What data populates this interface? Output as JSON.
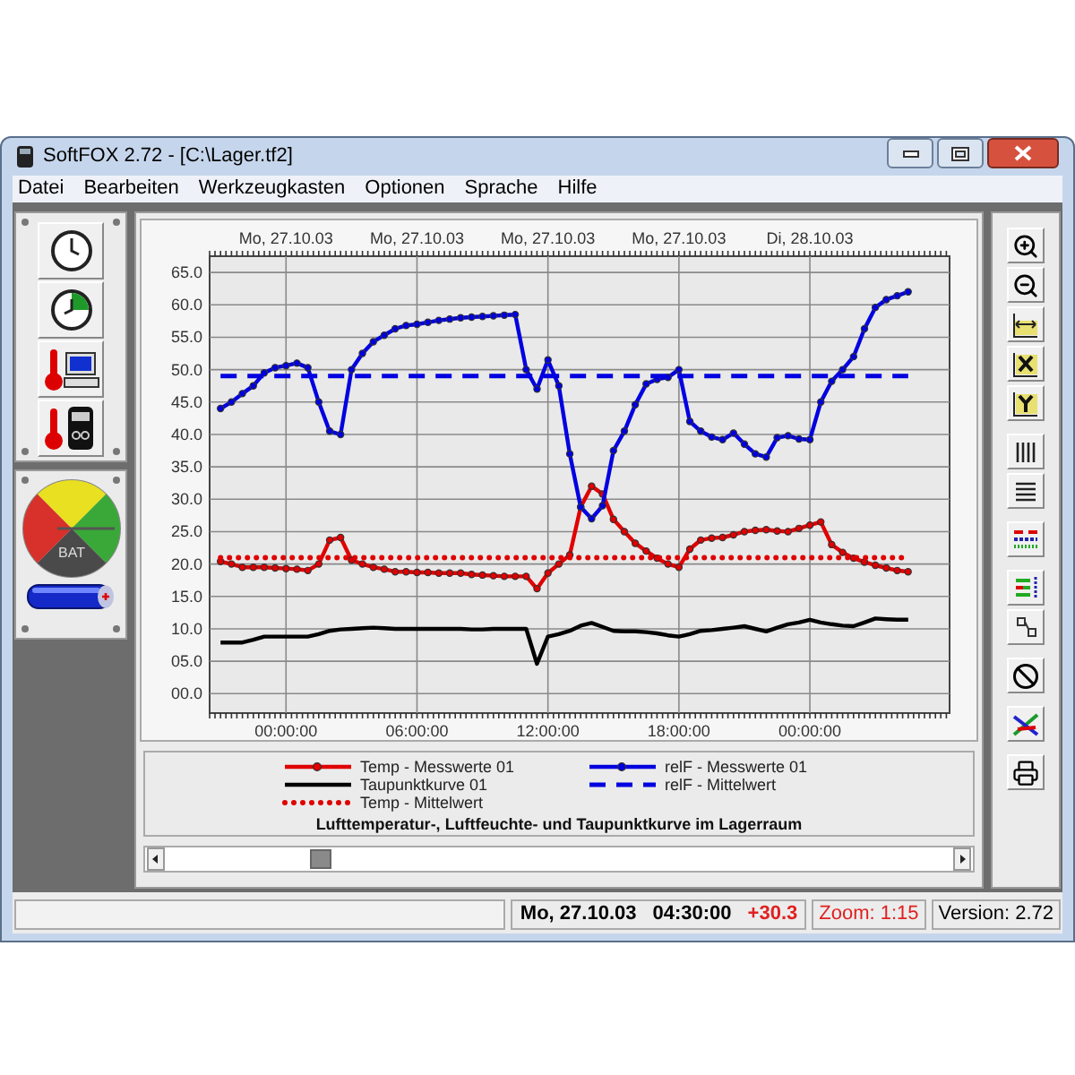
{
  "window": {
    "title": "SoftFOX 2.72 - [C:\\Lager.tf2]"
  },
  "menu": [
    "Datei",
    "Bearbeiten",
    "Werkzeugkasten",
    "Optionen",
    "Sprache",
    "Hilfe"
  ],
  "battery_gauge": {
    "label": "BAT"
  },
  "chart": {
    "date_labels": [
      "Mo, 27.10.03",
      "Mo, 27.10.03",
      "Mo, 27.10.03",
      "Mo, 27.10.03",
      "Di, 28.10.03"
    ],
    "chart_data": {
      "type": "line",
      "title": "Lufttemperatur-, Luftfeuchte- und Taupunktkurve im Lagerraum",
      "grid": true,
      "x": [
        "--10-26 21:00",
        "--10-26 21:30",
        "--10-26 22:00",
        "--10-26 22:30",
        "--10-26 23:00",
        "--10-26 23:30",
        "--10-27 00:00",
        "--10-27 00:30",
        "--10-27 01:00",
        "--10-27 01:30",
        "--10-27 02:00",
        "--10-27 02:30",
        "--10-27 03:00",
        "--10-27 03:30",
        "--10-27 04:00",
        "--10-27 04:30",
        "--10-27 05:00",
        "--10-27 05:30",
        "--10-27 06:00",
        "--10-27 06:30",
        "--10-27 07:00",
        "--10-27 07:30",
        "--10-27 08:00",
        "--10-27 08:30",
        "--10-27 09:00",
        "--10-27 09:30",
        "--10-27 10:00",
        "--10-27 10:30",
        "--10-27 11:00",
        "--10-27 11:30",
        "--10-27 12:00",
        "--10-27 12:30",
        "--10-27 13:00",
        "--10-27 13:30",
        "--10-27 14:00",
        "--10-27 14:30",
        "--10-27 15:00",
        "--10-27 15:30",
        "--10-27 16:00",
        "--10-27 16:30",
        "--10-27 17:00",
        "--10-27 17:30",
        "--10-27 18:00",
        "--10-27 18:30",
        "--10-27 19:00",
        "--10-27 19:30",
        "--10-27 20:00",
        "--10-27 20:30",
        "--10-27 21:00",
        "--10-27 21:30",
        "--10-27 22:00",
        "--10-27 22:30",
        "--10-27 23:00",
        "--10-27 23:30",
        "--10-28 00:00",
        "--10-28 00:30",
        "--10-28 01:00",
        "--10-28 01:30",
        "--10-28 02:00",
        "--10-28 02:30",
        "--10-28 03:00",
        "--10-28 03:30",
        "--10-28 04:00",
        "--10-28 04:30"
      ],
      "xlim": [
        "--10-26 20:30",
        "--10-28 06:24"
      ],
      "ylim": [
        -3,
        67.5
      ],
      "xticks": [
        {
          "value": "--10-27 00:00",
          "label": "00:00:00"
        },
        {
          "value": "--10-27 06:00",
          "label": "06:00:00"
        },
        {
          "value": "--10-27 12:00",
          "label": "12:00:00"
        },
        {
          "value": "--10-27 18:00",
          "label": "18:00:00"
        },
        {
          "value": "--10-28 00:00",
          "label": "00:00:00"
        }
      ],
      "yticks": [
        {
          "value": 0,
          "label": "00.0"
        },
        {
          "value": 5,
          "label": "05.0"
        },
        {
          "value": 10,
          "label": "10.0"
        },
        {
          "value": 15,
          "label": "15.0"
        },
        {
          "value": 20,
          "label": "20.0"
        },
        {
          "value": 25,
          "label": "25.0"
        },
        {
          "value": 30,
          "label": "30.0"
        },
        {
          "value": 35,
          "label": "35.0"
        },
        {
          "value": 40,
          "label": "40.0"
        },
        {
          "value": 45,
          "label": "45.0"
        },
        {
          "value": 50,
          "label": "50.0"
        },
        {
          "value": 55,
          "label": "55.0"
        },
        {
          "value": 60,
          "label": "60.0"
        },
        {
          "value": 65,
          "label": "65.0"
        }
      ],
      "series": [
        {
          "name": "Temp - Messwerte 01",
          "color": "#e00000",
          "line_style": "solid",
          "marker": "circle",
          "values": [
            20.4,
            20,
            19.5,
            19.5,
            19.5,
            19.4,
            19.3,
            19.2,
            19,
            20,
            23.7,
            24.1,
            20.6,
            20,
            19.5,
            19.2,
            18.8,
            18.8,
            18.7,
            18.7,
            18.6,
            18.6,
            18.6,
            18.4,
            18.3,
            18.2,
            18.1,
            18.1,
            18.1,
            16.2,
            18.6,
            20,
            21.4,
            28.8,
            32,
            30.8,
            26.9,
            25,
            23.2,
            22,
            20.9,
            20,
            19.5,
            22.3,
            23.7,
            24,
            24.1,
            24.5,
            25,
            25.2,
            25.3,
            25.1,
            25,
            25.5,
            26,
            26.5,
            23,
            21.8,
            20.9,
            20.3,
            19.8,
            19.4,
            19,
            18.8
          ]
        },
        {
          "name": "relF - Messwerte 01",
          "color": "#0000e0",
          "line_style": "solid",
          "marker": "circle",
          "values": [
            44,
            45,
            46.3,
            47.5,
            49.5,
            50.3,
            50.6,
            51,
            50.3,
            45,
            40.5,
            40,
            50,
            52.5,
            54.3,
            55.3,
            56.3,
            56.8,
            57,
            57.3,
            57.6,
            57.8,
            58,
            58.1,
            58.2,
            58.3,
            58.4,
            58.5,
            50,
            47,
            51.5,
            47.5,
            37,
            28.8,
            27,
            29,
            37.5,
            40.5,
            44.6,
            47.8,
            48.5,
            48.8,
            50,
            42,
            40.5,
            39.6,
            39.2,
            40.2,
            38.5,
            37,
            36.5,
            39.5,
            39.8,
            39.3,
            39.2,
            45,
            48.2,
            50,
            52,
            56.3,
            59.6,
            60.8,
            61.4,
            62
          ]
        },
        {
          "name": "Taupunktkurve 01",
          "color": "#000000",
          "line_style": "solid",
          "values": [
            7.9,
            7.9,
            7.9,
            8.3,
            8.8,
            8.8,
            8.8,
            8.8,
            8.8,
            9.2,
            9.7,
            9.9,
            10,
            10.1,
            10.2,
            10.1,
            10,
            10,
            10,
            10,
            10,
            10,
            10,
            9.9,
            9.9,
            10,
            10,
            10,
            10,
            4.6,
            8.8,
            9.2,
            9.7,
            10.5,
            10.9,
            10.3,
            9.7,
            9.6,
            9.6,
            9.5,
            9.3,
            9,
            8.8,
            9.2,
            9.7,
            9.8,
            10,
            10.2,
            10.4,
            10,
            9.6,
            10.2,
            10.7,
            11,
            11.4,
            11,
            10.7,
            10.5,
            10.4,
            11,
            11.6,
            11.5,
            11.4,
            11.4
          ]
        },
        {
          "name": "relF - Mittelwert",
          "color": "#0000e0",
          "line_style": "dashed",
          "values": [
            49,
            49,
            49,
            49,
            49,
            49,
            49,
            49,
            49,
            49,
            49,
            49,
            49,
            49,
            49,
            49,
            49,
            49,
            49,
            49,
            49,
            49,
            49,
            49,
            49,
            49,
            49,
            49,
            49,
            49,
            49,
            49,
            49,
            49,
            49,
            49,
            49,
            49,
            49,
            49,
            49,
            49,
            49,
            49,
            49,
            49,
            49,
            49,
            49,
            49,
            49,
            49,
            49,
            49,
            49,
            49,
            49,
            49,
            49,
            49,
            49,
            49,
            49,
            49
          ]
        },
        {
          "name": "Temp - Mittelwert",
          "color": "#e00000",
          "line_style": "dotted",
          "values": [
            21,
            21,
            21,
            21,
            21,
            21,
            21,
            21,
            21,
            21,
            21,
            21,
            21,
            21,
            21,
            21,
            21,
            21,
            21,
            21,
            21,
            21,
            21,
            21,
            21,
            21,
            21,
            21,
            21,
            21,
            21,
            21,
            21,
            21,
            21,
            21,
            21,
            21,
            21,
            21,
            21,
            21,
            21,
            21,
            21,
            21,
            21,
            21,
            21,
            21,
            21,
            21,
            21,
            21,
            21,
            21,
            21,
            21,
            21,
            21,
            21,
            21,
            21,
            21
          ]
        }
      ]
    }
  },
  "status_bar": {
    "date": "Mo, 27.10.03",
    "time": "04:30:00",
    "value": "+30.3",
    "zoom": "Zoom: 1:15",
    "version": "Version: 2.72"
  }
}
